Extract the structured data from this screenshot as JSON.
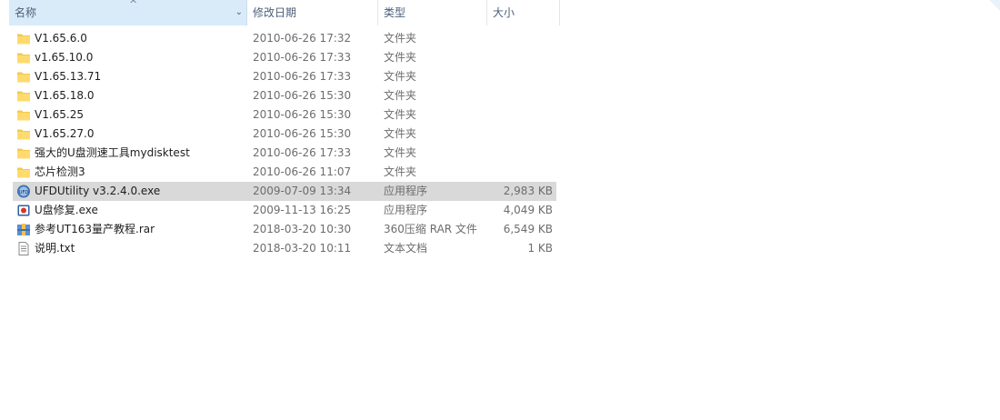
{
  "columns": {
    "name": "名称",
    "date": "修改日期",
    "type": "类型",
    "size": "大小"
  },
  "rows": [
    {
      "icon": "folder-icon",
      "name": "V1.65.6.0",
      "date": "2010-06-26 17:32",
      "type": "文件夹",
      "size": "",
      "selected": false
    },
    {
      "icon": "folder-icon",
      "name": "v1.65.10.0",
      "date": "2010-06-26 17:33",
      "type": "文件夹",
      "size": "",
      "selected": false
    },
    {
      "icon": "folder-icon",
      "name": "V1.65.13.71",
      "date": "2010-06-26 17:33",
      "type": "文件夹",
      "size": "",
      "selected": false
    },
    {
      "icon": "folder-icon",
      "name": "V1.65.18.0",
      "date": "2010-06-26 15:30",
      "type": "文件夹",
      "size": "",
      "selected": false
    },
    {
      "icon": "folder-icon",
      "name": "V1.65.25",
      "date": "2010-06-26 15:30",
      "type": "文件夹",
      "size": "",
      "selected": false
    },
    {
      "icon": "folder-icon",
      "name": "V1.65.27.0",
      "date": "2010-06-26 15:30",
      "type": "文件夹",
      "size": "",
      "selected": false
    },
    {
      "icon": "folder-icon",
      "name": "强大的U盘测速工具mydisktest",
      "date": "2010-06-26 17:33",
      "type": "文件夹",
      "size": "",
      "selected": false
    },
    {
      "icon": "folder-icon",
      "name": "芯片检测3",
      "date": "2010-06-26 11:07",
      "type": "文件夹",
      "size": "",
      "selected": false
    },
    {
      "icon": "ufd-app-icon",
      "name": "UFDUtility v3.2.4.0.exe",
      "date": "2009-07-09 13:34",
      "type": "应用程序",
      "size": "2,983 KB",
      "selected": true
    },
    {
      "icon": "repair-app-icon",
      "name": "U盘修复.exe",
      "date": "2009-11-13 16:25",
      "type": "应用程序",
      "size": "4,049 KB",
      "selected": false
    },
    {
      "icon": "rar-archive-icon",
      "name": "参考UT163量产教程.rar",
      "date": "2018-03-20 10:30",
      "type": "360压缩 RAR 文件",
      "size": "6,549 KB",
      "selected": false
    },
    {
      "icon": "text-file-icon",
      "name": "说明.txt",
      "date": "2018-03-20 10:11",
      "type": "文本文档",
      "size": "1 KB",
      "selected": false
    }
  ]
}
